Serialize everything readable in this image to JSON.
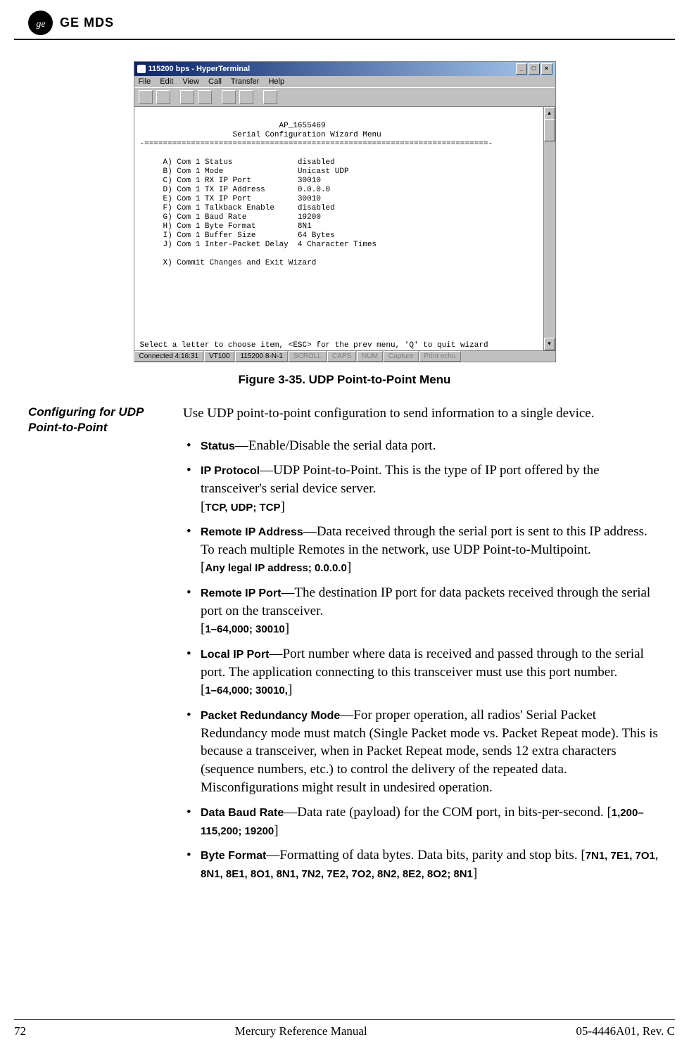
{
  "header": {
    "brand": "GE MDS"
  },
  "terminal": {
    "title": "115200 bps - HyperTerminal",
    "menu": [
      "File",
      "Edit",
      "View",
      "Call",
      "Transfer",
      "Help"
    ],
    "device_name": "AP_1655469",
    "menu_title": "Serial Configuration Wizard Menu",
    "rule": "-==========================================================================-",
    "items": [
      {
        "key": "A)",
        "label": "Com 1 Status",
        "value": "disabled"
      },
      {
        "key": "B)",
        "label": "Com 1 Mode",
        "value": "Unicast UDP"
      },
      {
        "key": "C)",
        "label": "Com 1 RX IP Port",
        "value": "30010"
      },
      {
        "key": "D)",
        "label": "Com 1 TX IP Address",
        "value": "0.0.0.0"
      },
      {
        "key": "E)",
        "label": "Com 1 TX IP Port",
        "value": "30010"
      },
      {
        "key": "F)",
        "label": "Com 1 Talkback Enable",
        "value": "disabled"
      },
      {
        "key": "G)",
        "label": "Com 1 Baud Rate",
        "value": "19200"
      },
      {
        "key": "H)",
        "label": "Com 1 Byte Format",
        "value": "8N1"
      },
      {
        "key": "I)",
        "label": "Com 1 Buffer Size",
        "value": "64 Bytes"
      },
      {
        "key": "J)",
        "label": "Com 1 Inter-Packet Delay",
        "value": "4 Character Times"
      }
    ],
    "commit_line": "     X) Commit Changes and Exit Wizard",
    "prompt": "Select a letter to choose item, <ESC> for the prev menu, 'Q' to quit wizard",
    "status": {
      "connected": "Connected 4:16:31",
      "emulation": "VT100",
      "settings": "115200 8-N-1",
      "scroll": "SCROLL",
      "caps": "CAPS",
      "num": "NUM",
      "capture": "Capture",
      "printecho": "Print echo"
    }
  },
  "figure_caption": "Figure 3-35. UDP Point-to-Point Menu",
  "section": {
    "side_heading": "Configuring for UDP Point-to-Point",
    "intro": "Use UDP point-to-point configuration to send information to a single device.",
    "params": [
      {
        "name": "Status",
        "desc": "—Enable/Disable the serial data port."
      },
      {
        "name": "IP Protocol",
        "desc": "—UDP Point-to-Point. This is the type of IP port offered by the transceiver's serial device server.",
        "range": "TCP, UDP; TCP"
      },
      {
        "name": "Remote IP Address",
        "desc": "—Data received through the serial port is sent to this IP address. To reach multiple Remotes in the network, use UDP Point-to-Multipoint.",
        "range": "Any legal IP address; 0.0.0.0"
      },
      {
        "name": "Remote IP Port",
        "desc": "—The destination IP port for data packets received through the serial port on the transceiver.",
        "range": "1–64,000; 30010"
      },
      {
        "name": "Local IP Port",
        "desc": "—Port number where data is received and passed through to the serial port. The application connecting to this transceiver must use this port number.",
        "range": "1–64,000; 30010,"
      },
      {
        "name": "Packet Redundancy Mode",
        "desc": "—For proper operation, all radios' Serial Packet Redundancy mode must match (Single Packet mode vs. Packet Repeat mode). This is because a transceiver, when in Packet Repeat mode, sends 12 extra characters (sequence numbers, etc.) to control the delivery of the repeated data. Misconfigurations might result in undesired operation."
      },
      {
        "name": "Data Baud Rate",
        "desc_pre": "—Data rate (payload) for the ",
        "com_word": "COM",
        "desc_post": " port, in bits-per-second. ",
        "range_inline": "1,200–115,200; 19200"
      },
      {
        "name": "Byte Format",
        "desc": "—Formatting of data bytes. Data bits, parity and stop bits. ",
        "range_inline": "7N1, 7E1, 7O1, 8N1, 8E1, 8O1, 8N1, 7N2, 7E2, 7O2, 8N2, 8E2, 8O2; 8N1"
      }
    ]
  },
  "footer": {
    "page": "72",
    "title": "Mercury Reference Manual",
    "doc": "05-4446A01, Rev. C"
  }
}
